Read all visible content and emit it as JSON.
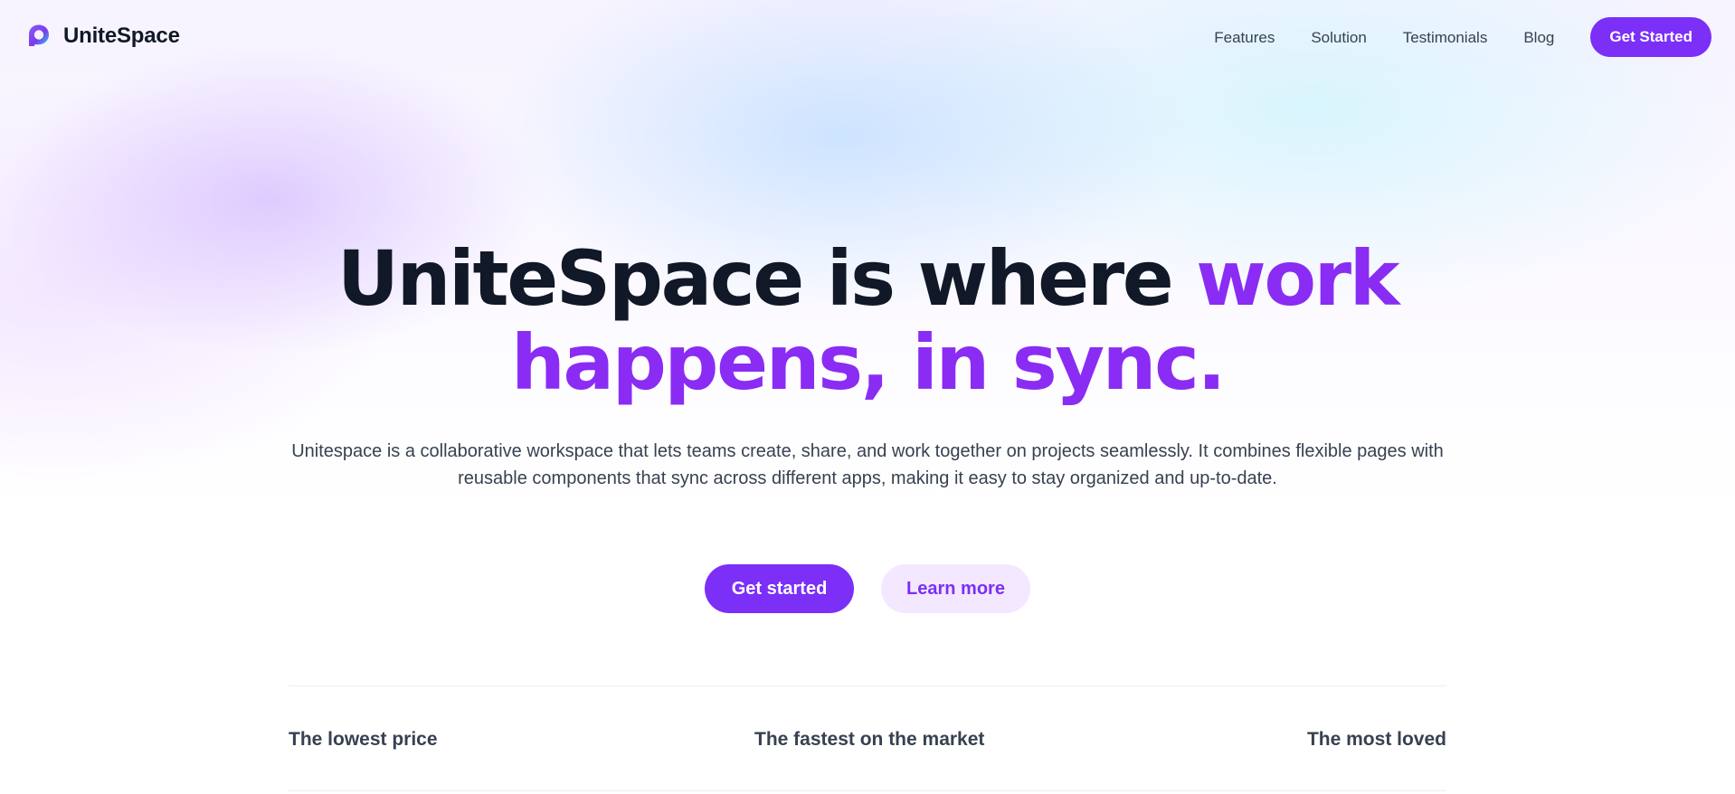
{
  "brand": {
    "name": "UniteSpace",
    "logo_icon": "unitespace-logo-icon"
  },
  "nav": {
    "links": [
      {
        "label": "Features"
      },
      {
        "label": "Solution"
      },
      {
        "label": "Testimonials"
      },
      {
        "label": "Blog"
      }
    ],
    "cta_label": "Get Started"
  },
  "hero": {
    "title_dark": "UniteSpace is where ",
    "title_accent": "work happens, in sync.",
    "subtitle": "Unitespace is a collaborative workspace that lets teams create, share, and work together on projects seamlessly. It combines flexible pages with reusable components that sync across different apps, making it easy to stay organized and up-to-date.",
    "primary_cta": "Get started",
    "secondary_cta": "Learn more"
  },
  "features": [
    {
      "label": "The lowest price"
    },
    {
      "label": "The fastest on the market"
    },
    {
      "label": "The most loved"
    }
  ],
  "colors": {
    "accent": "#7B2FF7",
    "accent_light": "#F3E8FF",
    "heading": "#111827",
    "body_text": "#374151"
  }
}
